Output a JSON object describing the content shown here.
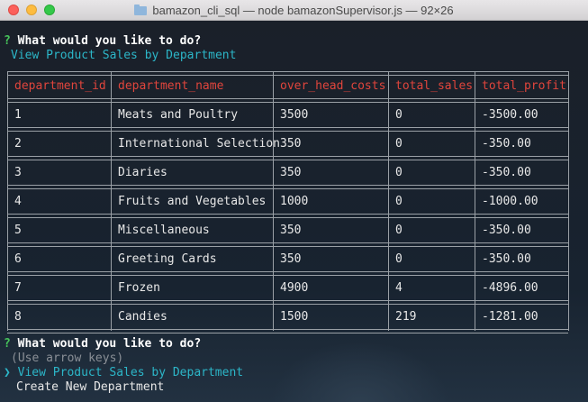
{
  "window": {
    "title": "bamazon_cli_sql — node bamazonSupervisor.js — 92×26"
  },
  "prompt1": {
    "mark": "?",
    "question": "What would you like to do?",
    "answer": "View Product Sales by Department"
  },
  "table": {
    "headers": [
      "department_id",
      "department_name",
      "over_head_costs",
      "total_sales",
      "total_profit"
    ],
    "rows": [
      [
        "1",
        "Meats and Poultry",
        "3500",
        "0",
        "-3500.00"
      ],
      [
        "2",
        "International Selection",
        "350",
        "0",
        "-350.00"
      ],
      [
        "3",
        "Diaries",
        "350",
        "0",
        "-350.00"
      ],
      [
        "4",
        "Fruits and Vegetables",
        "1000",
        "0",
        "-1000.00"
      ],
      [
        "5",
        "Miscellaneous",
        "350",
        "0",
        "-350.00"
      ],
      [
        "6",
        "Greeting Cards",
        "350",
        "0",
        "-350.00"
      ],
      [
        "7",
        "Frozen",
        "4900",
        "4",
        "-4896.00"
      ],
      [
        "8",
        "Candies",
        "1500",
        "219",
        "-1281.00"
      ]
    ]
  },
  "prompt2": {
    "mark": "?",
    "question": "What would you like to do?",
    "hint": "(Use arrow keys)",
    "pointer": "❯",
    "options": [
      "View Product Sales by Department",
      "Create New Department"
    ]
  },
  "colors": {
    "header": "#e0453c",
    "answer": "#2cb6c8",
    "prompt_mark": "#47c45b"
  }
}
